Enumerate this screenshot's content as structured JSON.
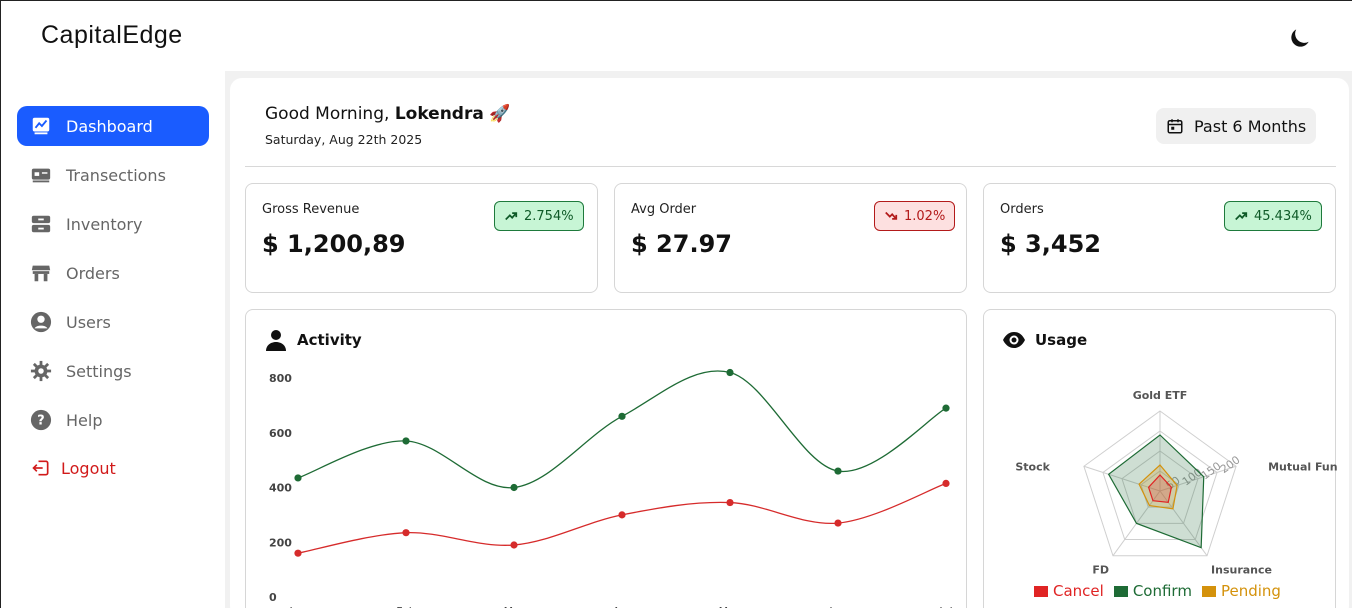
{
  "app": {
    "brand": "CapitalEdge"
  },
  "sidebar": {
    "items": [
      {
        "label": "Dashboard",
        "icon": "dashboard-icon"
      },
      {
        "label": "Transections",
        "icon": "transactions-icon"
      },
      {
        "label": "Inventory",
        "icon": "inventory-icon"
      },
      {
        "label": "Orders",
        "icon": "orders-icon"
      },
      {
        "label": "Users",
        "icon": "user-circle-icon"
      },
      {
        "label": "Settings",
        "icon": "gear-icon"
      },
      {
        "label": "Help",
        "icon": "help-icon"
      }
    ],
    "logout": "Logout"
  },
  "header": {
    "greeting": "Good Morning, ",
    "user": "Lokendra",
    "emoji": "🚀",
    "date": "Saturday, Aug 22th 2025",
    "range": "Past 6 Months"
  },
  "cards": [
    {
      "label": "Gross Revenue",
      "value": "$ 1,200,89",
      "badge": "2.754%",
      "trend": "up"
    },
    {
      "label": "Avg Order",
      "value": "$ 27.97",
      "badge": "1.02%",
      "trend": "down"
    },
    {
      "label": "Orders",
      "value": "$ 3,452",
      "badge": "45.434%",
      "trend": "up"
    }
  ],
  "activity": {
    "title": "Activity",
    "chart_data": {
      "type": "line",
      "y_ticks": [
        "800",
        "600",
        "400",
        "200",
        "0"
      ],
      "ylim": [
        0,
        800
      ],
      "x": [
        "Jan",
        "Feb",
        "Mar",
        "Apr",
        "May",
        "Jun",
        "Jul"
      ],
      "series": [
        {
          "values": [
            435,
            570,
            400,
            660,
            820,
            460,
            690
          ],
          "color": "#1e6b35"
        },
        {
          "values": [
            160,
            235,
            190,
            300,
            345,
            270,
            415
          ],
          "color": "#d62b2b"
        }
      ]
    }
  },
  "usage": {
    "title": "Usage",
    "chart_data": {
      "type": "radar",
      "axes": [
        "Gold ETF",
        "Mutual Funds",
        "Insurance",
        "FD",
        "Stock"
      ],
      "scale_max": 200,
      "ring_labels": [
        "200",
        "150",
        "100",
        "50"
      ],
      "series": [
        {
          "name": "Cancel",
          "values": [
            40,
            30,
            35,
            30,
            30
          ],
          "color": "#e02424"
        },
        {
          "name": "Confirm",
          "values": [
            140,
            115,
            175,
            100,
            135
          ],
          "color": "#1e6b35"
        },
        {
          "name": "Pending",
          "values": [
            65,
            45,
            55,
            45,
            55
          ],
          "color": "#d4920c"
        }
      ]
    }
  }
}
